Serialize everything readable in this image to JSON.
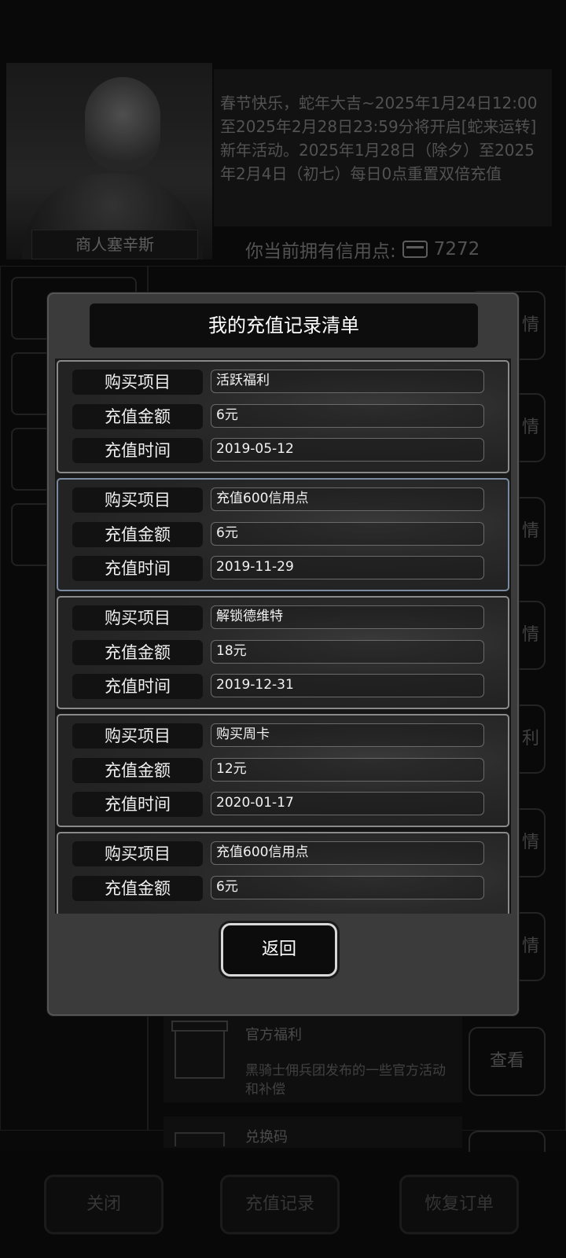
{
  "background": {
    "merchant_name": "商人塞辛斯",
    "notice": "春节快乐，蛇年大吉~2025年1月24日12:00至2025年2月28日23:59分将开启[蛇来运转]新年活动。2025年1月28日（除夕）至2025年2月4日（初七）每日0点重置双倍充值",
    "credits_label": "你当前拥有信用点:",
    "credits_value": "7272",
    "row_button_partial": "情",
    "row_button_partial_2": "利",
    "gift": {
      "title": "官方福利",
      "desc": "黑骑士佣兵团发布的一些官方活动和补偿",
      "button": "查看"
    },
    "code": {
      "title": "兑换码"
    },
    "bottom": {
      "close": "关闭",
      "records": "充值记录",
      "restore": "恢复订单"
    }
  },
  "modal": {
    "title": "我的充值记录清单",
    "labels": {
      "item": "购买项目",
      "amount": "充值金额",
      "time": "充值时间"
    },
    "records": [
      {
        "item": "活跃福利",
        "amount": "6元",
        "time": "2019-05-12"
      },
      {
        "item": "充值600信用点",
        "amount": "6元",
        "time": "2019-11-29"
      },
      {
        "item": "解锁德维特",
        "amount": "18元",
        "time": "2019-12-31"
      },
      {
        "item": "购买周卡",
        "amount": "12元",
        "time": "2020-01-17"
      },
      {
        "item": "充值600信用点",
        "amount": "6元"
      }
    ],
    "back_button": "返回"
  }
}
